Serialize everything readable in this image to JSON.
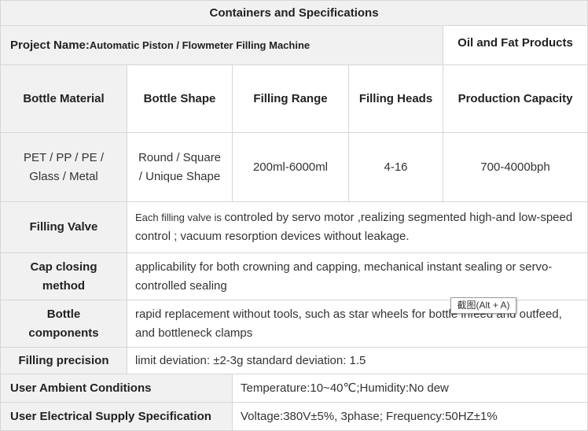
{
  "title": "Containers and Specifications",
  "project": {
    "label": "Project Name:",
    "name": "Automatic Piston / Flowmeter Filling Machine",
    "category": "Oil and Fat Products"
  },
  "columns": [
    "Bottle Material",
    "Bottle Shape",
    "Filling Range",
    "Filling Heads",
    "Production Capacity"
  ],
  "values": {
    "material_line1": "PET / PP / PE /",
    "material_line2": "Glass / Metal",
    "shape_line1": "Round / Square",
    "shape_line2": "/ Unique Shape",
    "range": "200ml-6000ml",
    "heads": "4-16",
    "capacity": "700-4000bph"
  },
  "rows": {
    "valve": {
      "label": "Filling Valve",
      "text_small": "Each filling valve is ",
      "text": "controled by servo motor ,realizing segmented high-and low-speed control ; vacuum resorption devices without leakage."
    },
    "cap": {
      "label_line1": "Cap closing",
      "label_line2": "method",
      "text": "applicability for both crowning and capping, mechanical instant sealing or servo-controlled sealing"
    },
    "components": {
      "label_line1": "Bottle",
      "label_line2": "components",
      "text": "rapid replacement without tools, such as star wheels for bottle infeed and outfeed, and bottleneck clamps"
    },
    "precision": {
      "label": "Filling precision",
      "text": "limit deviation: ±2-3g standard deviation: 1.5"
    },
    "ambient": {
      "label": "User Ambient Conditions",
      "text": "Temperature:10~40℃;Humidity:No dew"
    },
    "electrical": {
      "label": "User Electrical Supply Specification",
      "text": "Voltage:380V±5%, 3phase; Frequency:50HZ±1%"
    }
  },
  "tooltip": "截图(Alt + A)"
}
